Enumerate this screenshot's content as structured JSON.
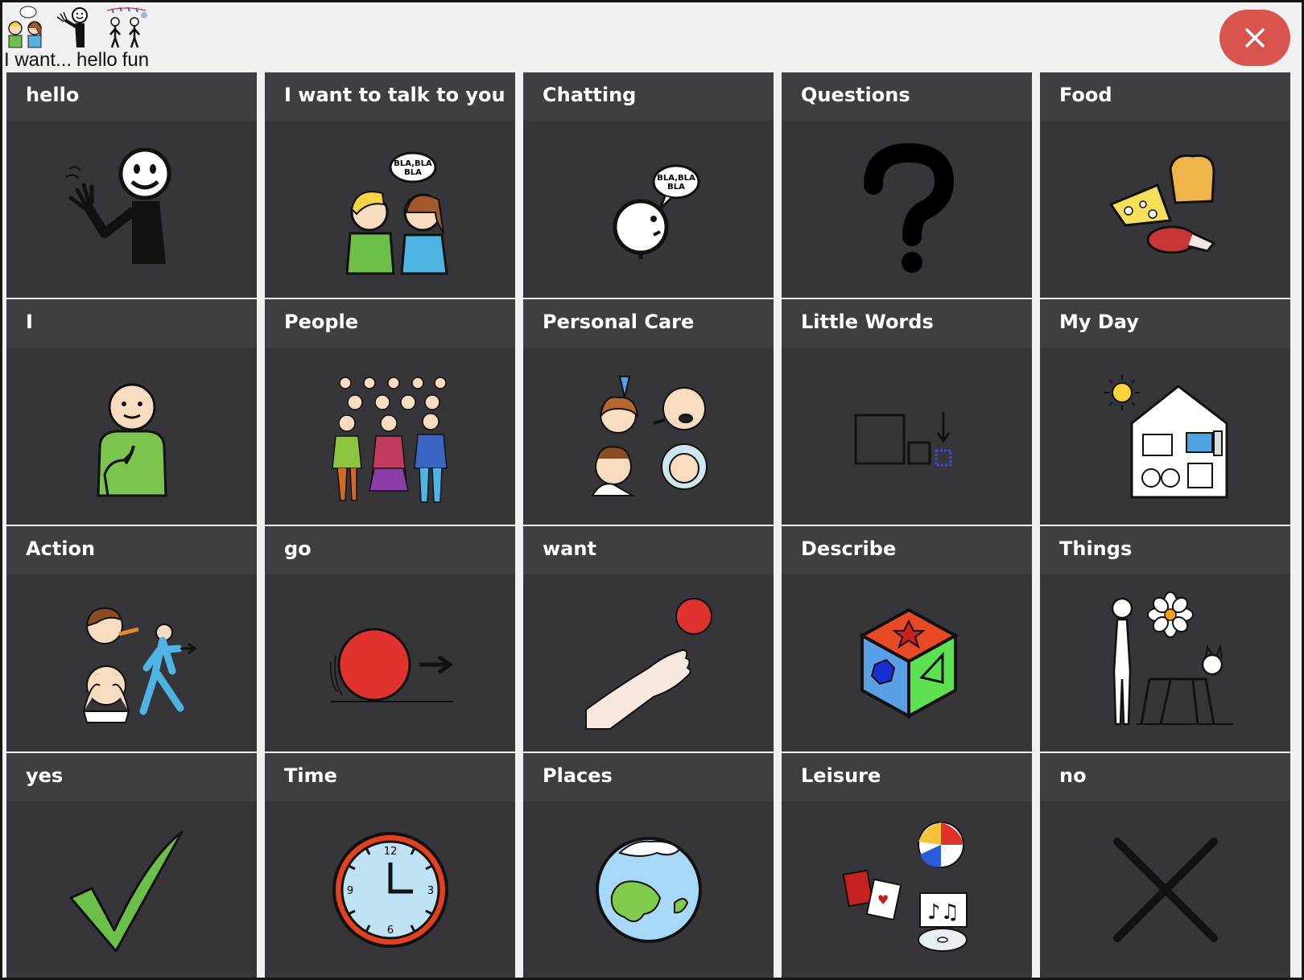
{
  "message_bar": {
    "words": [
      "I want...",
      "hello",
      "fun"
    ],
    "symbols": [
      "people-talking-icon",
      "waving-person-icon",
      "party-people-icon"
    ]
  },
  "close_button": {
    "icon": "close-icon",
    "color": "#d9534f"
  },
  "tiles": [
    {
      "label": "hello",
      "icon": "waving-person-icon"
    },
    {
      "label": "I want to talk to you",
      "icon": "two-people-talking-icon"
    },
    {
      "label": "Chatting",
      "icon": "speech-head-icon"
    },
    {
      "label": "Questions",
      "icon": "question-mark-icon"
    },
    {
      "label": "Food",
      "icon": "food-icon"
    },
    {
      "label": "I",
      "icon": "self-pointing-person-icon"
    },
    {
      "label": "People",
      "icon": "group-of-people-icon"
    },
    {
      "label": "Personal Care",
      "icon": "personal-care-icon"
    },
    {
      "label": "Little Words",
      "icon": "little-words-icon"
    },
    {
      "label": "My Day",
      "icon": "house-activities-icon"
    },
    {
      "label": "Action",
      "icon": "action-people-icon"
    },
    {
      "label": "go",
      "icon": "rolling-ball-icon"
    },
    {
      "label": "want",
      "icon": "hand-reaching-ball-icon"
    },
    {
      "label": "Describe",
      "icon": "shapes-cube-icon"
    },
    {
      "label": "Things",
      "icon": "person-flower-cat-icon"
    },
    {
      "label": "yes",
      "icon": "check-mark-icon"
    },
    {
      "label": "Time",
      "icon": "clock-icon"
    },
    {
      "label": "Places",
      "icon": "globe-icon"
    },
    {
      "label": "Leisure",
      "icon": "leisure-icon"
    },
    {
      "label": "no",
      "icon": "cross-icon"
    }
  ],
  "colors": {
    "tile_background": "#36363a",
    "tile_header": "#3f3f43",
    "page_background": "#f1f1f1"
  }
}
